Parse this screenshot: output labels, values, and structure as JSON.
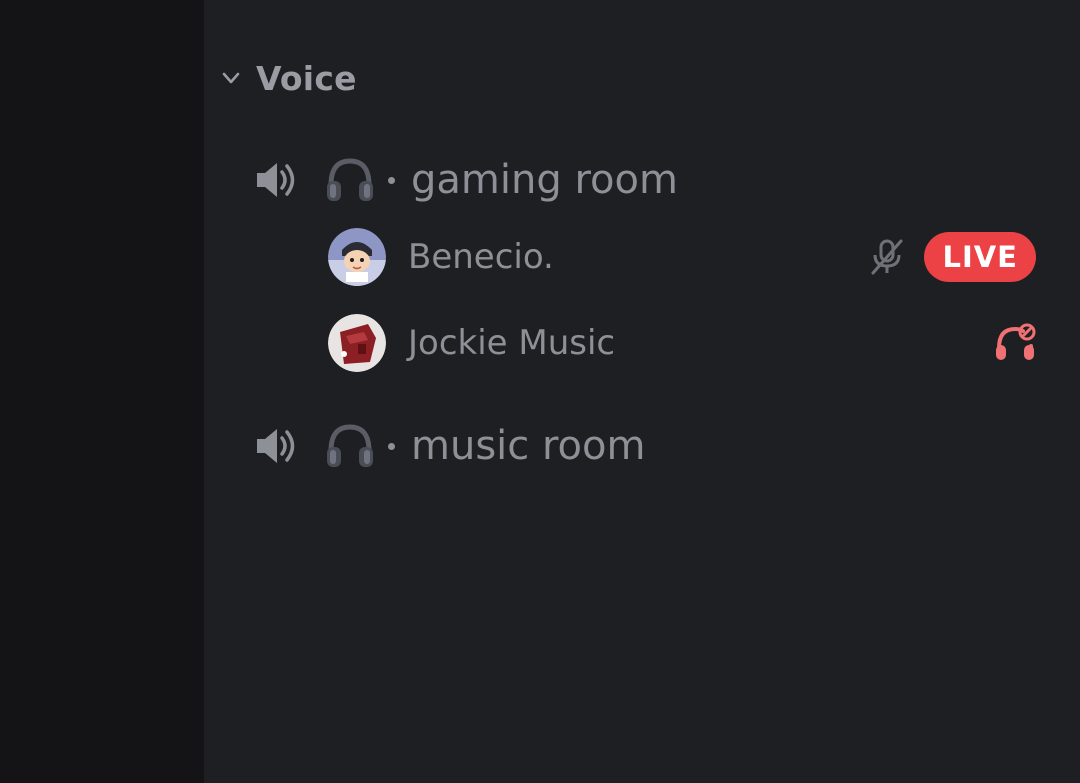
{
  "category": {
    "label": "Voice",
    "chevron_icon": "chevron-down-icon"
  },
  "channels": [
    {
      "name": "gaming room",
      "icon": "speaker-icon",
      "emoji": "headphones-emoji",
      "members": [
        {
          "name": "Benecio.",
          "avatar": "cartoon-boy-avatar",
          "muted": true,
          "live_label": "LIVE"
        },
        {
          "name": "Jockie Music",
          "avatar": "bot-avatar",
          "deafened": true
        }
      ]
    },
    {
      "name": "music room",
      "icon": "speaker-icon",
      "emoji": "headphones-emoji",
      "members": []
    }
  ],
  "colors": {
    "background": "#1e1f22",
    "rail": "#141316",
    "text_muted": "#8d9097",
    "live": "#ec4245",
    "deafen_icon": "#f07173"
  }
}
